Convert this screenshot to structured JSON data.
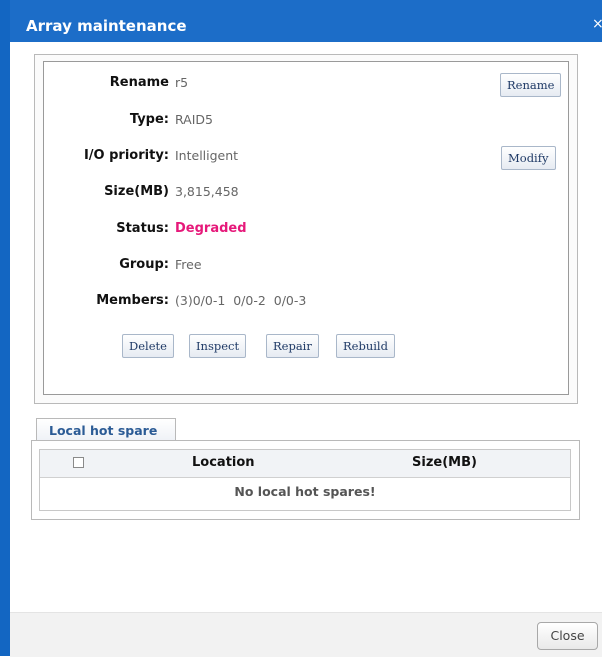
{
  "window": {
    "title": "Array maintenance",
    "close_glyph": "×"
  },
  "array": {
    "fields": [
      {
        "label": "Rename",
        "value": "r5"
      },
      {
        "label": "Type:",
        "value": "RAID5"
      },
      {
        "label": "I/O priority:",
        "value": "Intelligent"
      },
      {
        "label": "Size(MB)",
        "value": "3,815,458"
      },
      {
        "label": "Status:",
        "value": "Degraded"
      },
      {
        "label": "Group:",
        "value": "Free"
      },
      {
        "label": "Members:",
        "value": "(3)0/0-1  0/0-2  0/0-3"
      }
    ],
    "rename_button": "Rename",
    "modify_button": "Modify",
    "status_color": "#e6197a",
    "actions": {
      "delete": "Delete",
      "inspect": "Inspect",
      "repair": "Repair",
      "rebuild": "Rebuild"
    }
  },
  "hot_spare": {
    "tab_label": "Local hot spare",
    "columns": [
      "Location",
      "Size(MB)"
    ],
    "empty_message": "No local hot spares!"
  },
  "footer": {
    "close_button": "Close"
  },
  "colors": {
    "title_bar": "#1c6dc8",
    "tab_text": "#2b5b95"
  }
}
